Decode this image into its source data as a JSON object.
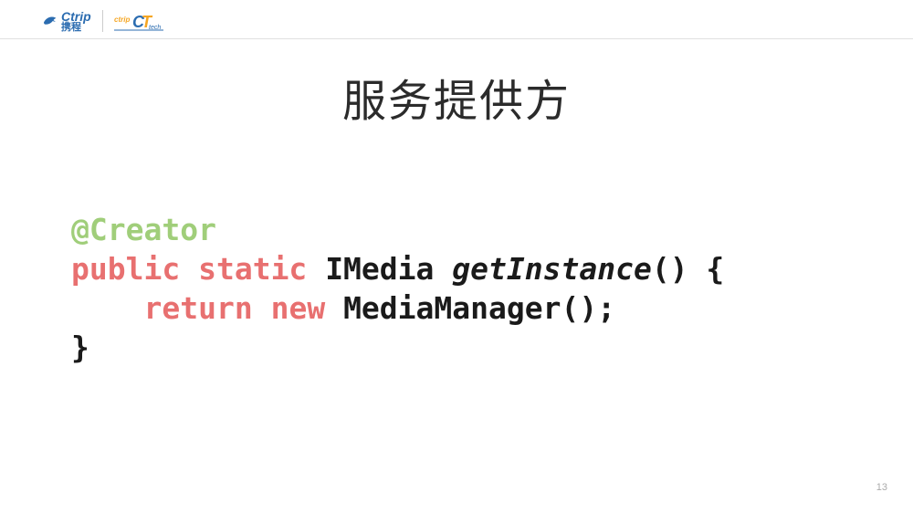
{
  "header": {
    "logo1_main": "Ctrip",
    "logo1_sub": "携程",
    "logo2": "ctripTech"
  },
  "slide": {
    "title": "服务提供方",
    "page_number": "13"
  },
  "code": {
    "line1_annotation": "@Creator",
    "line2_kw1": "public",
    "line2_kw2": "static",
    "line2_type": "IMedia",
    "line2_method": "getInstance",
    "line2_tail": "() {",
    "line3_indent": "    ",
    "line3_kw1": "return",
    "line3_kw2": "new",
    "line3_call": "MediaManager();",
    "line4": "}"
  }
}
